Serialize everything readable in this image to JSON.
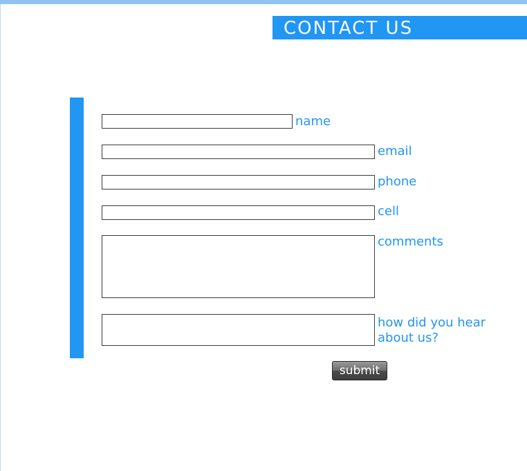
{
  "header": {
    "title": "CONTACT US"
  },
  "form": {
    "fields": [
      {
        "label": "name",
        "value": "",
        "type": "text"
      },
      {
        "label": "email",
        "value": "",
        "type": "text"
      },
      {
        "label": "phone",
        "value": "",
        "type": "text"
      },
      {
        "label": "cell",
        "value": "",
        "type": "text"
      },
      {
        "label": "comments",
        "value": "",
        "type": "textarea"
      },
      {
        "label": "how did you hear about us?",
        "value": "",
        "type": "textarea"
      }
    ],
    "submit_label": "submit"
  },
  "colors": {
    "accent": "#2196f3",
    "top_stripe": "#8fc4f2",
    "field_border": "#3a3a3a",
    "button_gradient_top": "#9a9a9a",
    "button_gradient_bottom": "#3e3e3e"
  }
}
